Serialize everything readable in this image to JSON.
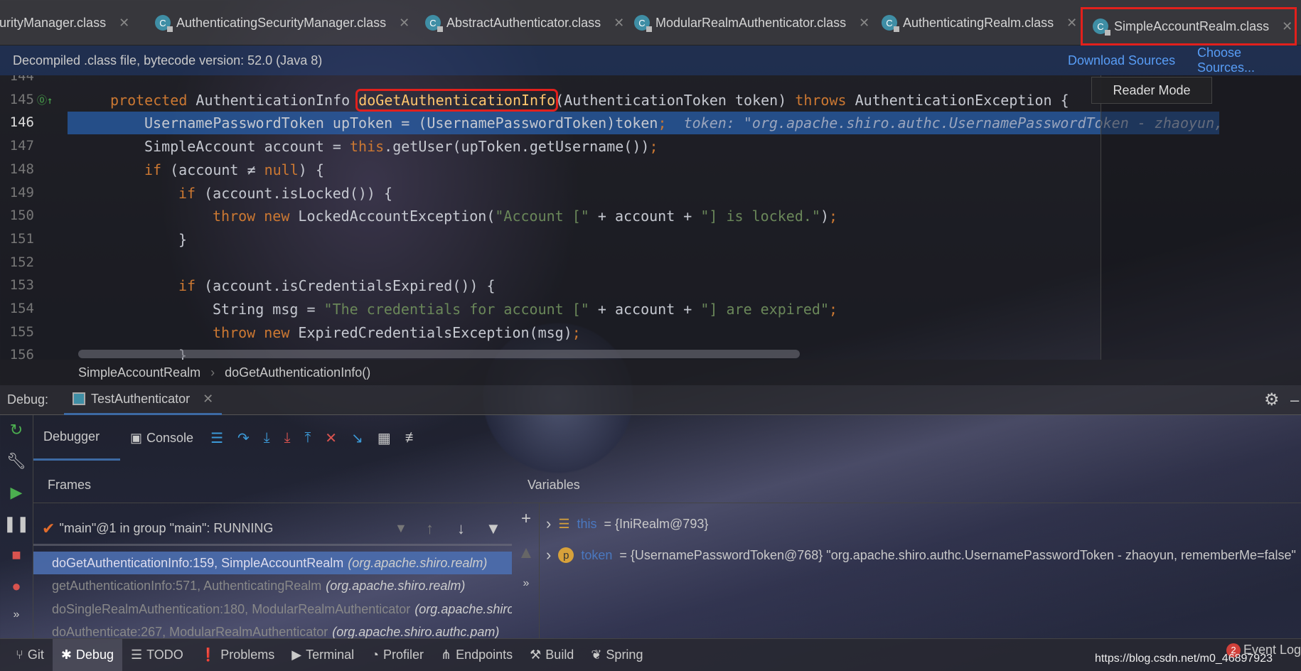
{
  "tabs": [
    {
      "label": "curityManager.class",
      "icon": "class-icon"
    },
    {
      "label": "AuthenticatingSecurityManager.class",
      "icon": "class-icon"
    },
    {
      "label": "AbstractAuthenticator.class",
      "icon": "class-icon"
    },
    {
      "label": "ModularRealmAuthenticator.class",
      "icon": "class-icon"
    },
    {
      "label": "AuthenticatingRealm.class",
      "icon": "class-icon"
    },
    {
      "label": "SimpleAccountRealm.class",
      "icon": "class-icon",
      "active": true
    }
  ],
  "close_glyph": "✕",
  "info_bar": {
    "message": "Decompiled .class file, bytecode version: 52.0 (Java 8)",
    "download_sources": "Download Sources",
    "choose_sources": "Choose Sources..."
  },
  "reader_mode": "Reader Mode",
  "editor": {
    "highlight_color": "#e2201c",
    "current_line": 146,
    "lines": [
      {
        "n": "144",
        "indent": 0,
        "tokens": []
      },
      {
        "n": "145",
        "indent": 0,
        "tokens": [
          [
            "protected ",
            "kw"
          ],
          [
            "AuthenticationInfo ",
            "pl"
          ],
          [
            "doGetAuthenticationInfo",
            "fn"
          ],
          [
            "(AuthenticationToken token) ",
            "pl"
          ],
          [
            "throws ",
            "kw"
          ],
          [
            "AuthenticationException {",
            "pl"
          ]
        ]
      },
      {
        "n": "146",
        "indent": 1,
        "tokens": [
          [
            "UsernamePasswordToken upToken = (UsernamePasswordToken)token",
            "pl"
          ],
          [
            ";",
            "kw"
          ],
          [
            "  token: \"org.apache.shiro.authc.UsernamePasswordToken - zhaoyun,",
            "hint"
          ]
        ]
      },
      {
        "n": "147",
        "indent": 1,
        "tokens": [
          [
            "SimpleAccount account = ",
            "pl"
          ],
          [
            "this",
            "kw"
          ],
          [
            ".getUser(upToken.getUsername())",
            "pl"
          ],
          [
            ";",
            "kw"
          ]
        ]
      },
      {
        "n": "148",
        "indent": 1,
        "tokens": [
          [
            "if ",
            "kw"
          ],
          [
            "(account ≠ ",
            "pl"
          ],
          [
            "null",
            "kw"
          ],
          [
            ") {",
            "pl"
          ]
        ]
      },
      {
        "n": "149",
        "indent": 2,
        "tokens": [
          [
            "if ",
            "kw"
          ],
          [
            "(account.isLocked()) {",
            "pl"
          ]
        ]
      },
      {
        "n": "150",
        "indent": 3,
        "tokens": [
          [
            "throw new ",
            "kw"
          ],
          [
            "LockedAccountException(",
            "pl"
          ],
          [
            "\"Account [\"",
            "str"
          ],
          [
            " + account + ",
            "pl"
          ],
          [
            "\"] is locked.\"",
            "str"
          ],
          [
            ")",
            "pl"
          ],
          [
            ";",
            "kw"
          ]
        ]
      },
      {
        "n": "151",
        "indent": 2,
        "tokens": [
          [
            "}",
            "pl"
          ]
        ]
      },
      {
        "n": "152",
        "indent": 0,
        "tokens": []
      },
      {
        "n": "153",
        "indent": 2,
        "tokens": [
          [
            "if ",
            "kw"
          ],
          [
            "(account.isCredentialsExpired()) {",
            "pl"
          ]
        ]
      },
      {
        "n": "154",
        "indent": 3,
        "tokens": [
          [
            "String msg = ",
            "pl"
          ],
          [
            "\"The credentials for account [\"",
            "str"
          ],
          [
            " + account + ",
            "pl"
          ],
          [
            "\"] are expired\"",
            "str"
          ],
          [
            ";",
            "kw"
          ]
        ]
      },
      {
        "n": "155",
        "indent": 3,
        "tokens": [
          [
            "throw new ",
            "kw"
          ],
          [
            "ExpiredCredentialsException(msg)",
            "pl"
          ],
          [
            ";",
            "kw"
          ]
        ]
      },
      {
        "n": "156",
        "indent": 2,
        "tokens": [
          [
            "}",
            "pl"
          ]
        ]
      }
    ]
  },
  "breadcrumb": [
    "SimpleAccountRealm",
    "doGetAuthenticationInfo()"
  ],
  "breadcrumb_sep": "›",
  "debug": {
    "label": "Debug:",
    "session": "TestAuthenticator",
    "tabs": {
      "debugger": "Debugger",
      "console": "Console"
    },
    "frames_title": "Frames",
    "variables_title": "Variables",
    "thread": "\"main\"@1 in group \"main\": RUNNING",
    "frames": [
      {
        "method": "doGetAuthenticationInfo:159, SimpleAccountRealm",
        "pkg": "(org.apache.shiro.realm)",
        "selected": true
      },
      {
        "method": "getAuthenticationInfo:571, AuthenticatingRealm",
        "pkg": "(org.apache.shiro.realm)"
      },
      {
        "method": "doSingleRealmAuthentication:180, ModularRealmAuthenticator",
        "pkg": "(org.apache.shiro"
      },
      {
        "method": "doAuthenticate:267, ModularRealmAuthenticator",
        "pkg": "(org.apache.shiro.authc.pam)"
      }
    ],
    "variables": [
      {
        "name": "this",
        "value": "= {IniRealm@793}",
        "icon": "field-icon"
      },
      {
        "name": "token",
        "value": "= {UsernamePasswordToken@768} \"org.apache.shiro.authc.UsernamePasswordToken - zhaoyun, rememberMe=false\"",
        "icon": "parameter-icon",
        "badge": "p"
      }
    ]
  },
  "bottom_tabs": [
    {
      "label": "Git",
      "icon": "git-icon"
    },
    {
      "label": "Debug",
      "icon": "bug-icon",
      "active": true
    },
    {
      "label": "TODO",
      "icon": "list-icon"
    },
    {
      "label": "Problems",
      "icon": "problems-icon"
    },
    {
      "label": "Terminal",
      "icon": "terminal-icon"
    },
    {
      "label": "Profiler",
      "icon": "profiler-icon"
    },
    {
      "label": "Endpoints",
      "icon": "endpoints-icon"
    },
    {
      "label": "Build",
      "icon": "hammer-icon"
    },
    {
      "label": "Spring",
      "icon": "spring-leaf-icon"
    }
  ],
  "event_log": {
    "label": "Event Log",
    "count": "2"
  },
  "watermark": "https://blog.csdn.net/m0_46897923"
}
